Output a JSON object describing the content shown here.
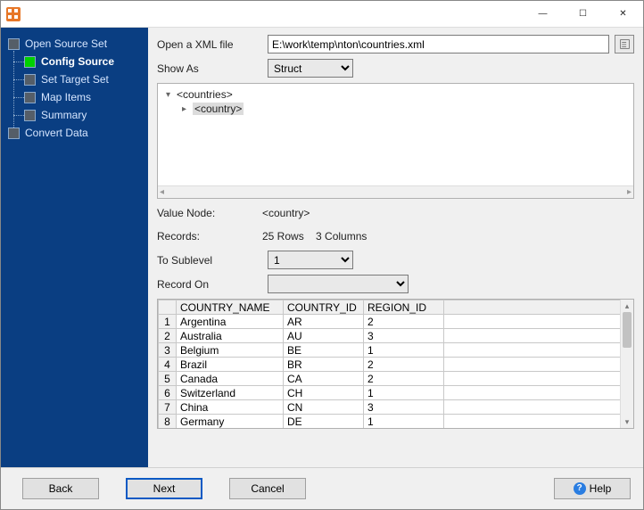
{
  "window": {
    "min": "—",
    "max": "☐",
    "close": "✕"
  },
  "sidebar": {
    "items": [
      {
        "label": "Open Source Set",
        "level": "parent"
      },
      {
        "label": "Config Source",
        "level": "child",
        "active": true
      },
      {
        "label": "Set Target Set",
        "level": "child"
      },
      {
        "label": "Map Items",
        "level": "child"
      },
      {
        "label": "Summary",
        "level": "child"
      },
      {
        "label": "Convert Data",
        "level": "parent"
      }
    ]
  },
  "form": {
    "open_label": "Open a XML file",
    "open_value": "E:\\work\\temp\\nton\\countries.xml",
    "showas_label": "Show As",
    "showas_value": "Struct",
    "valuenode_label": "Value Node:",
    "valuenode_value": "<country>",
    "records_label": "Records:",
    "records_value": "25 Rows    3 Columns",
    "tosub_label": "To Sublevel",
    "tosub_value": "1",
    "recordon_label": "Record On",
    "recordon_value": ""
  },
  "tree": {
    "root": "<countries>",
    "child": "<country>"
  },
  "table": {
    "columns": [
      "COUNTRY_NAME",
      "COUNTRY_ID",
      "REGION_ID"
    ],
    "rows": [
      [
        "Argentina",
        "AR",
        "2"
      ],
      [
        "Australia",
        "AU",
        "3"
      ],
      [
        "Belgium",
        "BE",
        "1"
      ],
      [
        "Brazil",
        "BR",
        "2"
      ],
      [
        "Canada",
        "CA",
        "2"
      ],
      [
        "Switzerland",
        "CH",
        "1"
      ],
      [
        "China",
        "CN",
        "3"
      ],
      [
        "Germany",
        "DE",
        "1"
      ]
    ]
  },
  "footer": {
    "back": "Back",
    "next": "Next",
    "cancel": "Cancel",
    "help": "Help"
  }
}
